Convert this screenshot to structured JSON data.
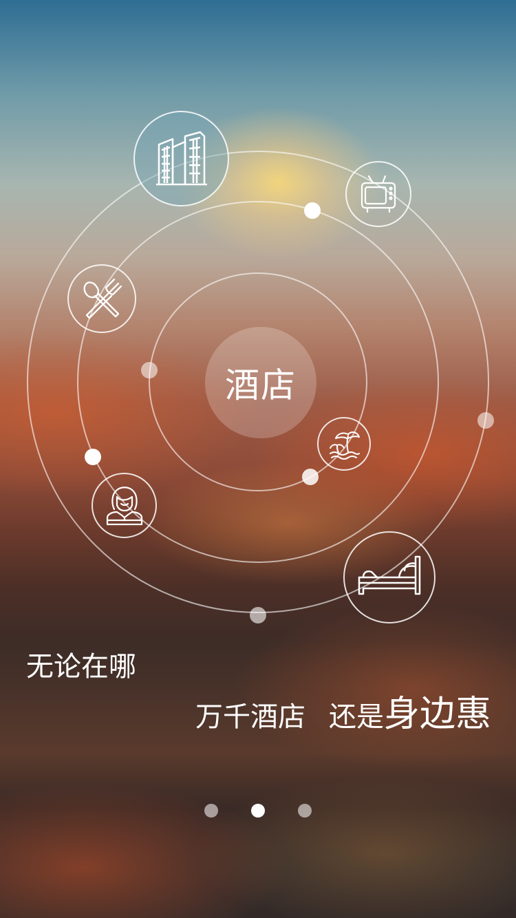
{
  "center": {
    "label": "酒店"
  },
  "icons": [
    {
      "name": "hotel-building-icon"
    },
    {
      "name": "tv-icon"
    },
    {
      "name": "dining-icon"
    },
    {
      "name": "beach-icon"
    },
    {
      "name": "receptionist-icon"
    },
    {
      "name": "bed-icon"
    }
  ],
  "caption": {
    "line1": "无论在哪",
    "line2_part1": "万千酒店",
    "line2_part2": "还是",
    "line2_emphasis": "身边惠"
  },
  "pager": {
    "count": 3,
    "active_index": 1
  },
  "colors": {
    "line": "#ffffff",
    "dot_active": "#ffffff",
    "dot_inactive": "#bfbfbf"
  }
}
